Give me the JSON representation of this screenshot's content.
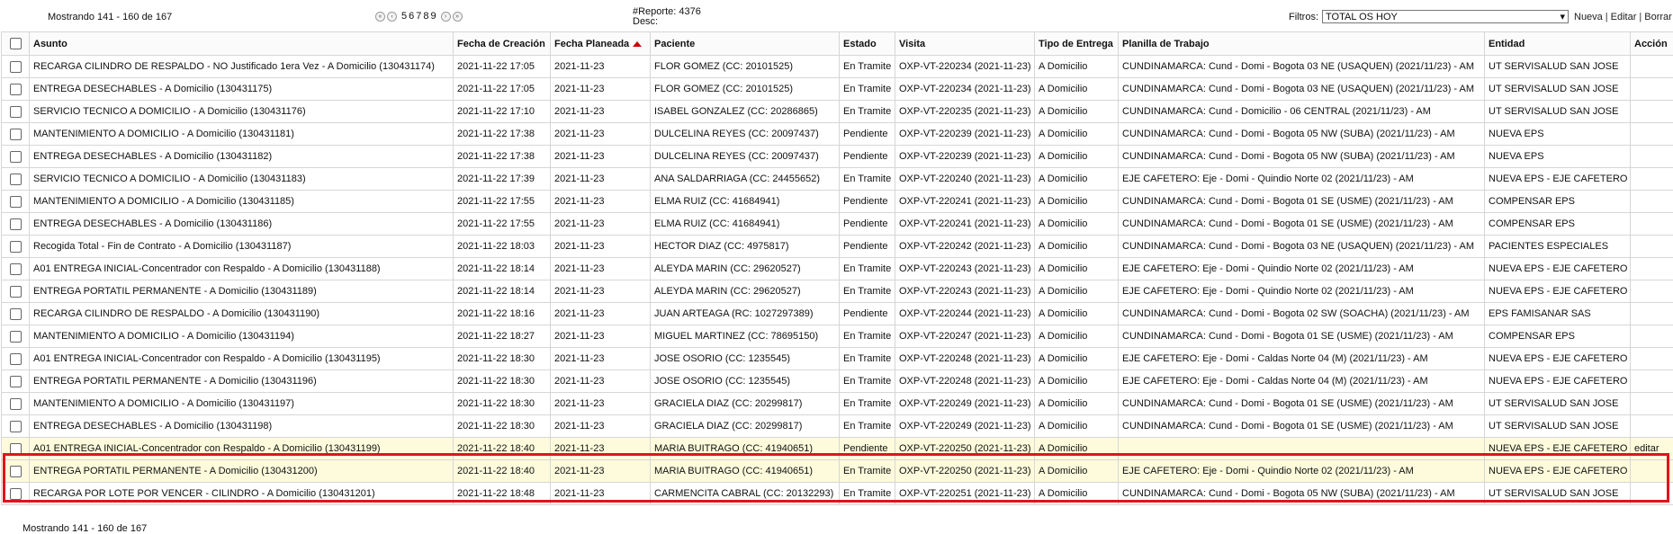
{
  "pager": {
    "showing": "Mostrando 141 - 160 de 167",
    "pages": [
      "5",
      "6",
      "7",
      "8",
      "9"
    ],
    "nav_icons": [
      "first-icon",
      "prev-icon",
      "next-icon",
      "last-icon"
    ]
  },
  "report": {
    "line1": "#Reporte: 4376",
    "line2": "Desc:"
  },
  "filters": {
    "label": "Filtros:",
    "selected": "TOTAL OS HOY",
    "links": [
      "Nueva",
      "Editar",
      "Borrar"
    ]
  },
  "columns": [
    "Asunto",
    "Fecha de Creación",
    "Fecha Planeada",
    "Paciente",
    "Estado",
    "Visita",
    "Tipo de Entrega",
    "Planilla de Trabajo",
    "Entidad",
    "Acción"
  ],
  "rows": [
    [
      "RECARGA CILINDRO DE RESPALDO - NO Justificado 1era Vez - A Domicilio (130431174)",
      "2021-11-22 17:05",
      "2021-11-23",
      "FLOR GOMEZ (CC: 20101525)",
      "En Tramite",
      "OXP-VT-220234 (2021-11-23)",
      "A Domicilio",
      "CUNDINAMARCA: Cund - Domi - Bogota 03 NE (USAQUEN) (2021/11/23) - AM",
      "UT SERVISALUD SAN JOSE",
      ""
    ],
    [
      "ENTREGA DESECHABLES - A Domicilio (130431175)",
      "2021-11-22 17:05",
      "2021-11-23",
      "FLOR GOMEZ (CC: 20101525)",
      "En Tramite",
      "OXP-VT-220234 (2021-11-23)",
      "A Domicilio",
      "CUNDINAMARCA: Cund - Domi - Bogota 03 NE (USAQUEN) (2021/11/23) - AM",
      "UT SERVISALUD SAN JOSE",
      ""
    ],
    [
      "SERVICIO TECNICO A DOMICILIO - A Domicilio (130431176)",
      "2021-11-22 17:10",
      "2021-11-23",
      "ISABEL GONZALEZ (CC: 20286865)",
      "En Tramite",
      "OXP-VT-220235 (2021-11-23)",
      "A Domicilio",
      "CUNDINAMARCA: Cund - Domicilio - 06 CENTRAL (2021/11/23) - AM",
      "UT SERVISALUD SAN JOSE",
      ""
    ],
    [
      "MANTENIMIENTO A DOMICILIO - A Domicilio (130431181)",
      "2021-11-22 17:38",
      "2021-11-23",
      "DULCELINA REYES (CC: 20097437)",
      "Pendiente",
      "OXP-VT-220239 (2021-11-23)",
      "A Domicilio",
      "CUNDINAMARCA: Cund - Domi - Bogota 05 NW (SUBA) (2021/11/23) - AM",
      "NUEVA EPS",
      ""
    ],
    [
      "ENTREGA DESECHABLES - A Domicilio (130431182)",
      "2021-11-22 17:38",
      "2021-11-23",
      "DULCELINA REYES (CC: 20097437)",
      "Pendiente",
      "OXP-VT-220239 (2021-11-23)",
      "A Domicilio",
      "CUNDINAMARCA: Cund - Domi - Bogota 05 NW (SUBA) (2021/11/23) - AM",
      "NUEVA EPS",
      ""
    ],
    [
      "SERVICIO TECNICO A DOMICILIO - A Domicilio (130431183)",
      "2021-11-22 17:39",
      "2021-11-23",
      "ANA SALDARRIAGA (CC: 24455652)",
      "En Tramite",
      "OXP-VT-220240 (2021-11-23)",
      "A Domicilio",
      "EJE CAFETERO: Eje - Domi - Quindio Norte 02 (2021/11/23) - AM",
      "NUEVA EPS - EJE CAFETERO",
      ""
    ],
    [
      "MANTENIMIENTO A DOMICILIO - A Domicilio (130431185)",
      "2021-11-22 17:55",
      "2021-11-23",
      "ELMA RUIZ (CC: 41684941)",
      "Pendiente",
      "OXP-VT-220241 (2021-11-23)",
      "A Domicilio",
      "CUNDINAMARCA: Cund - Domi - Bogota 01 SE (USME) (2021/11/23) - AM",
      "COMPENSAR EPS",
      ""
    ],
    [
      "ENTREGA DESECHABLES - A Domicilio (130431186)",
      "2021-11-22 17:55",
      "2021-11-23",
      "ELMA RUIZ (CC: 41684941)",
      "Pendiente",
      "OXP-VT-220241 (2021-11-23)",
      "A Domicilio",
      "CUNDINAMARCA: Cund - Domi - Bogota 01 SE (USME) (2021/11/23) - AM",
      "COMPENSAR EPS",
      ""
    ],
    [
      "Recogida Total - Fin de Contrato - A Domicilio (130431187)",
      "2021-11-22 18:03",
      "2021-11-23",
      "HECTOR DIAZ (CC: 4975817)",
      "Pendiente",
      "OXP-VT-220242 (2021-11-23)",
      "A Domicilio",
      "CUNDINAMARCA: Cund - Domi - Bogota 03 NE (USAQUEN) (2021/11/23) - AM",
      "PACIENTES ESPECIALES",
      ""
    ],
    [
      "A01 ENTREGA INICIAL-Concentrador con Respaldo - A Domicilio (130431188)",
      "2021-11-22 18:14",
      "2021-11-23",
      "ALEYDA MARIN (CC: 29620527)",
      "En Tramite",
      "OXP-VT-220243 (2021-11-23)",
      "A Domicilio",
      "EJE CAFETERO: Eje - Domi - Quindio Norte 02 (2021/11/23) - AM",
      "NUEVA EPS - EJE CAFETERO",
      ""
    ],
    [
      "ENTREGA PORTATIL PERMANENTE - A Domicilio (130431189)",
      "2021-11-22 18:14",
      "2021-11-23",
      "ALEYDA MARIN (CC: 29620527)",
      "En Tramite",
      "OXP-VT-220243 (2021-11-23)",
      "A Domicilio",
      "EJE CAFETERO: Eje - Domi - Quindio Norte 02 (2021/11/23) - AM",
      "NUEVA EPS - EJE CAFETERO",
      ""
    ],
    [
      "RECARGA CILINDRO DE RESPALDO - A Domicilio (130431190)",
      "2021-11-22 18:16",
      "2021-11-23",
      "JUAN ARTEAGA (RC: 1027297389)",
      "Pendiente",
      "OXP-VT-220244 (2021-11-23)",
      "A Domicilio",
      "CUNDINAMARCA: Cund - Domi - Bogota 02 SW (SOACHA) (2021/11/23) - AM",
      "EPS FAMISANAR SAS",
      ""
    ],
    [
      "MANTENIMIENTO A DOMICILIO - A Domicilio (130431194)",
      "2021-11-22 18:27",
      "2021-11-23",
      "MIGUEL MARTINEZ (CC: 78695150)",
      "En Tramite",
      "OXP-VT-220247 (2021-11-23)",
      "A Domicilio",
      "CUNDINAMARCA: Cund - Domi - Bogota 01 SE (USME) (2021/11/23) - AM",
      "COMPENSAR EPS",
      ""
    ],
    [
      "A01 ENTREGA INICIAL-Concentrador con Respaldo - A Domicilio (130431195)",
      "2021-11-22 18:30",
      "2021-11-23",
      "JOSE OSORIO (CC: 1235545)",
      "En Tramite",
      "OXP-VT-220248 (2021-11-23)",
      "A Domicilio",
      "EJE CAFETERO: Eje - Domi - Caldas Norte 04 (M) (2021/11/23) - AM",
      "NUEVA EPS - EJE CAFETERO",
      ""
    ],
    [
      "ENTREGA PORTATIL PERMANENTE - A Domicilio (130431196)",
      "2021-11-22 18:30",
      "2021-11-23",
      "JOSE OSORIO (CC: 1235545)",
      "En Tramite",
      "OXP-VT-220248 (2021-11-23)",
      "A Domicilio",
      "EJE CAFETERO: Eje - Domi - Caldas Norte 04 (M) (2021/11/23) - AM",
      "NUEVA EPS - EJE CAFETERO",
      ""
    ],
    [
      "MANTENIMIENTO A DOMICILIO - A Domicilio (130431197)",
      "2021-11-22 18:30",
      "2021-11-23",
      "GRACIELA DIAZ (CC: 20299817)",
      "En Tramite",
      "OXP-VT-220249 (2021-11-23)",
      "A Domicilio",
      "CUNDINAMARCA: Cund - Domi - Bogota 01 SE (USME) (2021/11/23) - AM",
      "UT SERVISALUD SAN JOSE",
      ""
    ],
    [
      "ENTREGA DESECHABLES - A Domicilio (130431198)",
      "2021-11-22 18:30",
      "2021-11-23",
      "GRACIELA DIAZ (CC: 20299817)",
      "En Tramite",
      "OXP-VT-220249 (2021-11-23)",
      "A Domicilio",
      "CUNDINAMARCA: Cund - Domi - Bogota 01 SE (USME) (2021/11/23) - AM",
      "UT SERVISALUD SAN JOSE",
      ""
    ],
    [
      "A01 ENTREGA INICIAL-Concentrador con Respaldo - A Domicilio (130431199)",
      "2021-11-22 18:40",
      "2021-11-23",
      "MARIA BUITRAGO (CC: 41940651)",
      "Pendiente",
      "OXP-VT-220250 (2021-11-23)",
      "A Domicilio",
      "",
      "NUEVA EPS - EJE CAFETERO",
      "editar"
    ],
    [
      "ENTREGA PORTATIL PERMANENTE - A Domicilio (130431200)",
      "2021-11-22 18:40",
      "2021-11-23",
      "MARIA BUITRAGO (CC: 41940651)",
      "En Tramite",
      "OXP-VT-220250 (2021-11-23)",
      "A Domicilio",
      "EJE CAFETERO: Eje - Domi - Quindio Norte 02 (2021/11/23) - AM",
      "NUEVA EPS - EJE CAFETERO",
      ""
    ],
    [
      "RECARGA POR LOTE POR VENCER - CILINDRO - A Domicilio (130431201)",
      "2021-11-22 18:48",
      "2021-11-23",
      "CARMENCITA CABRAL (CC: 20132293)",
      "En Tramite",
      "OXP-VT-220251 (2021-11-23)",
      "A Domicilio",
      "CUNDINAMARCA: Cund - Domi - Bogota 05 NW (SUBA) (2021/11/23) - AM",
      "UT SERVISALUD SAN JOSE",
      ""
    ]
  ],
  "highlighted_row": 17,
  "colors": {
    "highlight": "#fdfbdc",
    "outline": "#e0141c"
  }
}
